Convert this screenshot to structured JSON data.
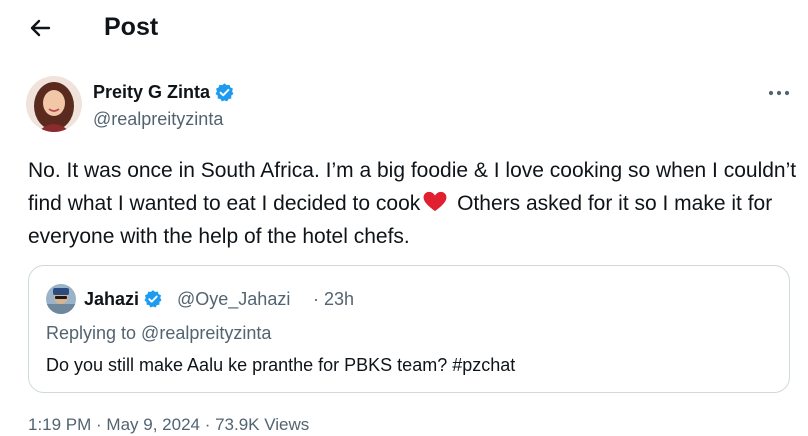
{
  "header": {
    "title": "Post",
    "back_icon": "arrow-left-icon"
  },
  "post": {
    "author_name": "Preity G Zinta",
    "author_handle": "@realpreityzinta",
    "text_part1": "No. It was once in South Africa. I’m a big foodie & I love cooking so when I couldn’t find what I wanted to eat I decided to cook",
    "text_part2": " Others asked for it so I make it for everyone with the help of the hotel chefs.",
    "emoji": "red-heart-icon",
    "more_icon": "more-horizontal-icon",
    "meta": "1:19 PM · May 9, 2024 · 73.9K Views"
  },
  "quote": {
    "author_name": "Jahazi",
    "author_handle": "@Oye_Jahazi",
    "time": "· 23h",
    "replying_to": "Replying to @realpreityzinta",
    "text": "Do you still make Aalu ke pranthe for PBKS team? #pzchat"
  },
  "colors": {
    "text_primary": "#0f1419",
    "text_secondary": "#536471",
    "verified_blue": "#1d9bf0",
    "border": "#cfd9de",
    "heart_red": "#e0202e"
  }
}
